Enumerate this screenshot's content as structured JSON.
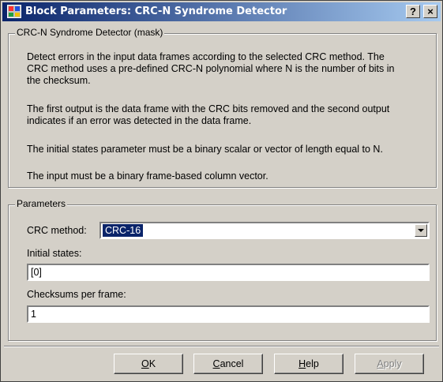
{
  "window": {
    "title": "Block Parameters: CRC-N Syndrome Detector",
    "help_glyph": "?",
    "close_glyph": "×"
  },
  "mask": {
    "group_label": "CRC-N Syndrome Detector (mask)",
    "lines": [
      "Detect errors in the input data frames according to the selected CRC method. The",
      "CRC method uses a pre-defined CRC-N polynomial where N is the number of bits in",
      "the checksum.",
      "The first output is the data frame with the CRC bits removed and the second output",
      "indicates if an error was detected in the data frame.",
      "The initial states parameter must be a binary scalar or vector of length equal to N.",
      "The input must be a binary frame-based column vector."
    ]
  },
  "parameters": {
    "group_label": "Parameters",
    "crc_method_label": "CRC method:",
    "crc_method_value": "CRC-16",
    "initial_states_label": "Initial states:",
    "initial_states_value": "[0]",
    "checksums_label": "Checksums per frame:",
    "checksums_value": "1"
  },
  "buttons": {
    "ok_mnemonic": "O",
    "ok_rest": "K",
    "cancel_mnemonic": "C",
    "cancel_rest": "ancel",
    "help_mnemonic": "H",
    "help_rest": "elp",
    "apply_mnemonic": "A",
    "apply_rest": "pply"
  },
  "colors": {
    "titlebar_start": "#0a246a",
    "titlebar_end": "#a6caf0",
    "face": "#d4d0c8",
    "selection": "#0a246a"
  },
  "icons": {
    "title": "simulink-block-icon",
    "dropdown": "chevron-down-icon"
  }
}
